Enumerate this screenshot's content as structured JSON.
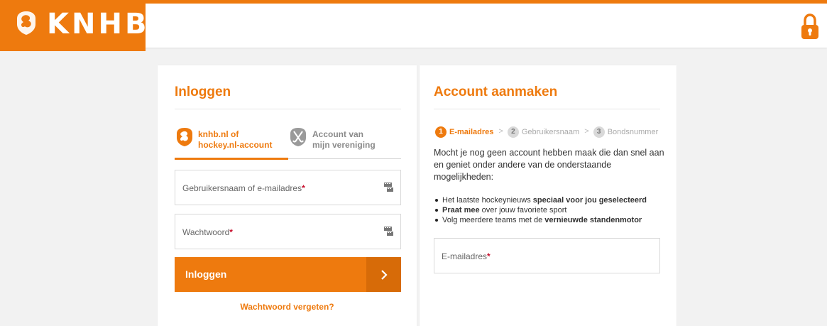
{
  "header": {
    "brand": "KNHB",
    "brand_color": "#ee7a0e",
    "lock_icon": "lock-icon"
  },
  "login": {
    "title": "Inloggen",
    "tabs": [
      {
        "label_line1": "knhb.nl of",
        "label_line2": "hockey.nl-account",
        "icon": "knhb-crest-icon",
        "active": true
      },
      {
        "label_line1": "Account van",
        "label_line2": "mijn vereniging",
        "icon": "crossed-sticks-icon",
        "active": false
      }
    ],
    "username_placeholder": "Gebruikersnaam of e-mailadres",
    "password_placeholder": "Wachtwoord",
    "required_mark": "*",
    "submit_label": "Inloggen",
    "forgot_label": "Wachtwoord vergeten?"
  },
  "create": {
    "title": "Account aanmaken",
    "steps": [
      {
        "num": "1",
        "label": "E-mailadres",
        "active": true
      },
      {
        "num": "2",
        "label": "Gebruikersnaam",
        "active": false
      },
      {
        "num": "3",
        "label": "Bondsnummer",
        "active": false
      }
    ],
    "step_separator": ">",
    "intro": "Mocht je nog geen account hebben maak die dan snel aan en geniet onder andere van de onderstaande mogelijkheden:",
    "bullets": [
      {
        "pre": "Het laatste hockeynieuws ",
        "bold": "speciaal voor jou geselecteerd",
        "post": ""
      },
      {
        "pre": "",
        "bold": "Praat mee",
        "post": " over jouw favoriete sport"
      },
      {
        "pre": "Volg meerdere teams met de ",
        "bold": "vernieuwde standenmotor",
        "post": ""
      }
    ],
    "email_placeholder": "E-mailadres",
    "required_mark": "*"
  }
}
